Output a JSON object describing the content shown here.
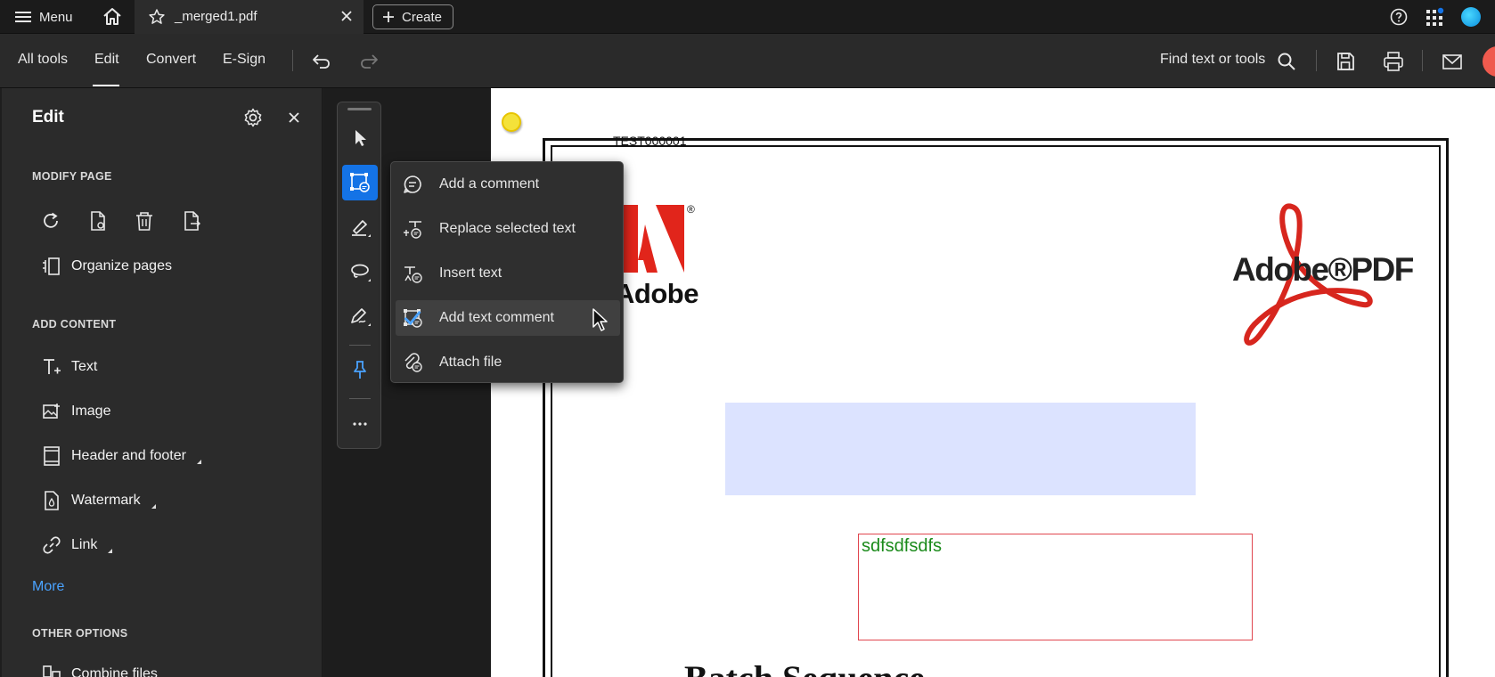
{
  "topbar": {
    "menu_label": "Menu",
    "tab_title": "_merged1.pdf",
    "create_label": "Create"
  },
  "toolbar": {
    "items": [
      "All tools",
      "Edit",
      "Convert",
      "E-Sign"
    ],
    "active": "Edit",
    "find_label": "Find text or tools"
  },
  "panel": {
    "title": "Edit",
    "modify_page_heading": "MODIFY PAGE",
    "organize_label": "Organize pages",
    "add_content_heading": "ADD CONTENT",
    "add_content_items": [
      "Text",
      "Image",
      "Header and footer",
      "Watermark",
      "Link"
    ],
    "more_label": "More",
    "other_options_heading": "OTHER OPTIONS",
    "other_first_item": "Combine files"
  },
  "popup_menu": {
    "items": [
      "Add a comment",
      "Replace selected text",
      "Insert text",
      "Add text comment",
      "Attach file"
    ],
    "selected": "Add text comment"
  },
  "pdf": {
    "test_label": "TEST000001",
    "adobe_word": "Adobe",
    "registered_mark": "®",
    "adobe_pdf_word": "Adobe®PDF",
    "comment_text": "sdfsdfsdfs",
    "batch_title": "Batch Sequence"
  },
  "colors": {
    "accent": "#1473e6",
    "link": "#4aa3ff",
    "comment_border": "#e0464e",
    "comment_text": "#1a8a1a",
    "highlight_rect": "#dce3ff",
    "adobe_red": "#e1251b"
  }
}
